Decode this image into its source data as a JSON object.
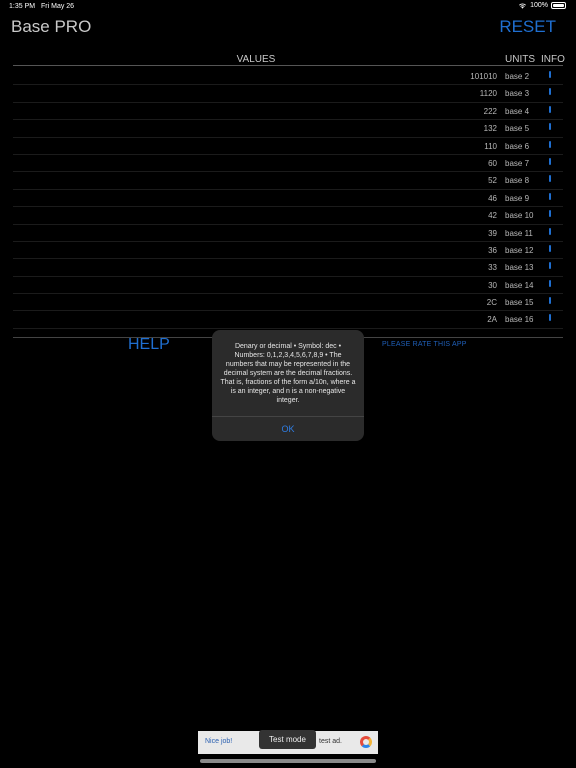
{
  "status_bar": {
    "time": "1:35 PM",
    "date": "Fri May 26",
    "battery": "100%",
    "battery_level": 1.0
  },
  "header": {
    "title": "Base PRO",
    "reset_label": "RESET"
  },
  "columns": {
    "values": "VALUES",
    "units": "UNITS",
    "info": "INFO"
  },
  "rows": [
    {
      "value": "101010",
      "unit": "base 2"
    },
    {
      "value": "1120",
      "unit": "base 3"
    },
    {
      "value": "222",
      "unit": "base 4"
    },
    {
      "value": "132",
      "unit": "base 5"
    },
    {
      "value": "110",
      "unit": "base 6"
    },
    {
      "value": "60",
      "unit": "base 7"
    },
    {
      "value": "52",
      "unit": "base 8"
    },
    {
      "value": "46",
      "unit": "base 9"
    },
    {
      "value": "42",
      "unit": "base 10"
    },
    {
      "value": "39",
      "unit": "base 11"
    },
    {
      "value": "36",
      "unit": "base 12"
    },
    {
      "value": "33",
      "unit": "base 13"
    },
    {
      "value": "30",
      "unit": "base 14"
    },
    {
      "value": "2C",
      "unit": "base 15"
    },
    {
      "value": "2A",
      "unit": "base 16"
    }
  ],
  "footer": {
    "help_label": "HELP",
    "rate_label": "PLEASE RATE THIS APP"
  },
  "alert": {
    "message": "Denary or decimal • Symbol: dec • Numbers: 0,1,2,3,4,5,6,7,8,9 • The numbers that may be represented in the decimal system are the decimal fractions. That is, fractions of the form a/10n, where a is an integer, and n is a non-negative integer.",
    "ok_label": "OK"
  },
  "ad": {
    "left_text": "Nice job!",
    "test_mode_label": "Test mode",
    "right_text": "test ad.",
    "icon": "ad-logo-icon"
  },
  "colors": {
    "accent": "#1f6fd1",
    "background": "#000000",
    "alert_bg": "#2b2b2b"
  }
}
